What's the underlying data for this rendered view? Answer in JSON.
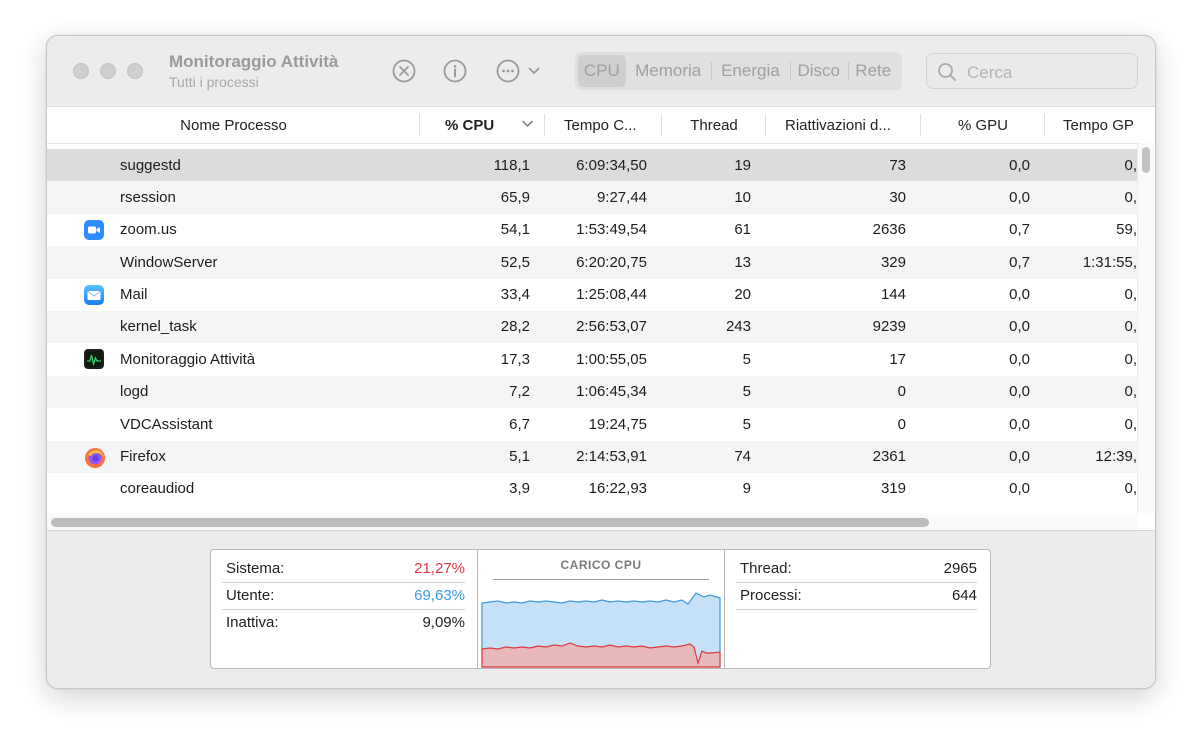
{
  "window": {
    "title": "Monitoraggio Attività",
    "subtitle": "Tutti i processi"
  },
  "toolbar": {
    "stop_icon": "x-circle-icon",
    "info_icon": "info-circle-icon",
    "more_icon": "ellipsis-circle-icon",
    "tabs": [
      {
        "label": "CPU",
        "selected": true
      },
      {
        "label": "Memoria",
        "selected": false
      },
      {
        "label": "Energia",
        "selected": false
      },
      {
        "label": "Disco",
        "selected": false
      },
      {
        "label": "Rete",
        "selected": false
      }
    ],
    "search_placeholder": "Cerca"
  },
  "table": {
    "columns": [
      "Nome Processo",
      "% CPU",
      "Tempo C...",
      "Thread",
      "Riattivazioni d...",
      "% GPU",
      "Tempo GP"
    ],
    "sorted_column": "% CPU",
    "rows": [
      {
        "name": "suggestd",
        "icon": "",
        "cpu": "118,1",
        "time": "6:09:34,50",
        "threads": "19",
        "wakeups": "73",
        "gpu": "0,0",
        "gputime": "0,"
      },
      {
        "name": "rsession",
        "icon": "",
        "cpu": "65,9",
        "time": "9:27,44",
        "threads": "10",
        "wakeups": "30",
        "gpu": "0,0",
        "gputime": "0,"
      },
      {
        "name": "zoom.us",
        "icon": "zoom-icon",
        "cpu": "54,1",
        "time": "1:53:49,54",
        "threads": "61",
        "wakeups": "2636",
        "gpu": "0,7",
        "gputime": "59,"
      },
      {
        "name": "WindowServer",
        "icon": "",
        "cpu": "52,5",
        "time": "6:20:20,75",
        "threads": "13",
        "wakeups": "329",
        "gpu": "0,7",
        "gputime": "1:31:55,"
      },
      {
        "name": "Mail",
        "icon": "mail-icon",
        "cpu": "33,4",
        "time": "1:25:08,44",
        "threads": "20",
        "wakeups": "144",
        "gpu": "0,0",
        "gputime": "0,"
      },
      {
        "name": "kernel_task",
        "icon": "",
        "cpu": "28,2",
        "time": "2:56:53,07",
        "threads": "243",
        "wakeups": "9239",
        "gpu": "0,0",
        "gputime": "0,"
      },
      {
        "name": "Monitoraggio Attività",
        "icon": "activity-monitor-icon",
        "cpu": "17,3",
        "time": "1:00:55,05",
        "threads": "5",
        "wakeups": "17",
        "gpu": "0,0",
        "gputime": "0,"
      },
      {
        "name": "logd",
        "icon": "",
        "cpu": "7,2",
        "time": "1:06:45,34",
        "threads": "5",
        "wakeups": "0",
        "gpu": "0,0",
        "gputime": "0,"
      },
      {
        "name": "VDCAssistant",
        "icon": "",
        "cpu": "6,7",
        "time": "19:24,75",
        "threads": "5",
        "wakeups": "0",
        "gpu": "0,0",
        "gputime": "0,"
      },
      {
        "name": "Firefox",
        "icon": "firefox-icon",
        "cpu": "5,1",
        "time": "2:14:53,91",
        "threads": "74",
        "wakeups": "2361",
        "gpu": "0,0",
        "gputime": "12:39,"
      },
      {
        "name": "coreaudiod",
        "icon": "",
        "cpu": "3,9",
        "time": "16:22,93",
        "threads": "9",
        "wakeups": "319",
        "gpu": "0,0",
        "gputime": "0,"
      }
    ]
  },
  "footer": {
    "left": [
      {
        "label": "Sistema:",
        "value": "21,27%",
        "color": "#e0383e"
      },
      {
        "label": "Utente:",
        "value": "69,63%",
        "color": "#3a9bdc"
      },
      {
        "label": "Inattiva:",
        "value": "9,09%",
        "color": "#1d1d1f"
      }
    ],
    "graph_title": "CARICO CPU",
    "right": [
      {
        "label": "Thread:",
        "value": "2965"
      },
      {
        "label": "Processi:",
        "value": "644"
      }
    ]
  },
  "colors": {
    "system": "#e0383e",
    "user": "#3a9bdc",
    "user_fill": "#c6e1f7",
    "system_fill": "#e8b9bb"
  }
}
